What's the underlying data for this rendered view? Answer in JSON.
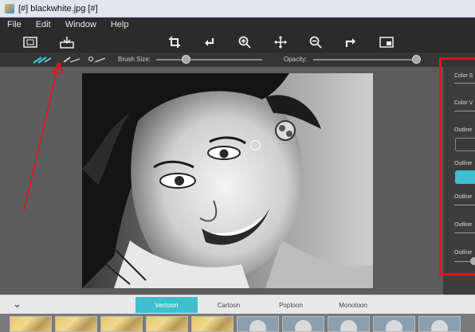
{
  "window": {
    "title": "[#] blackwhite.jpg [#]"
  },
  "menu": [
    "File",
    "Edit",
    "Window",
    "Help"
  ],
  "toolbar": {
    "buttons": [
      {
        "name": "fit-screen-icon",
        "glyph": "▣"
      },
      {
        "name": "save-icon",
        "glyph": "⎙"
      },
      {
        "name": "crop-icon",
        "glyph": "⌗"
      },
      {
        "name": "undo-icon",
        "glyph": "↩"
      },
      {
        "name": "zoom-in-icon",
        "glyph": "⊕"
      },
      {
        "name": "move-icon",
        "glyph": "✥"
      },
      {
        "name": "zoom-out-icon",
        "glyph": "⊖"
      },
      {
        "name": "redo-icon",
        "glyph": "↪"
      },
      {
        "name": "fullscreen-icon",
        "glyph": "⬒"
      }
    ]
  },
  "brushbar": {
    "brush_size_label": "Brush Size:",
    "brush_size_value": 0.28,
    "opacity_label": "Opacity:",
    "opacity_value": 0.97
  },
  "right_panel": {
    "labels": [
      "Color S",
      "Color V",
      "Outline",
      "Outline",
      "Outline",
      "Outline",
      "Outline"
    ],
    "accent": "#3fbfd0"
  },
  "presets": {
    "tabs": [
      "Vectoon",
      "Cartoon",
      "Poptoon",
      "Monotoon"
    ],
    "active_tab": "Vectoon"
  },
  "colors": {
    "accent": "#3fbfd0",
    "highlight": "#e3141c"
  }
}
